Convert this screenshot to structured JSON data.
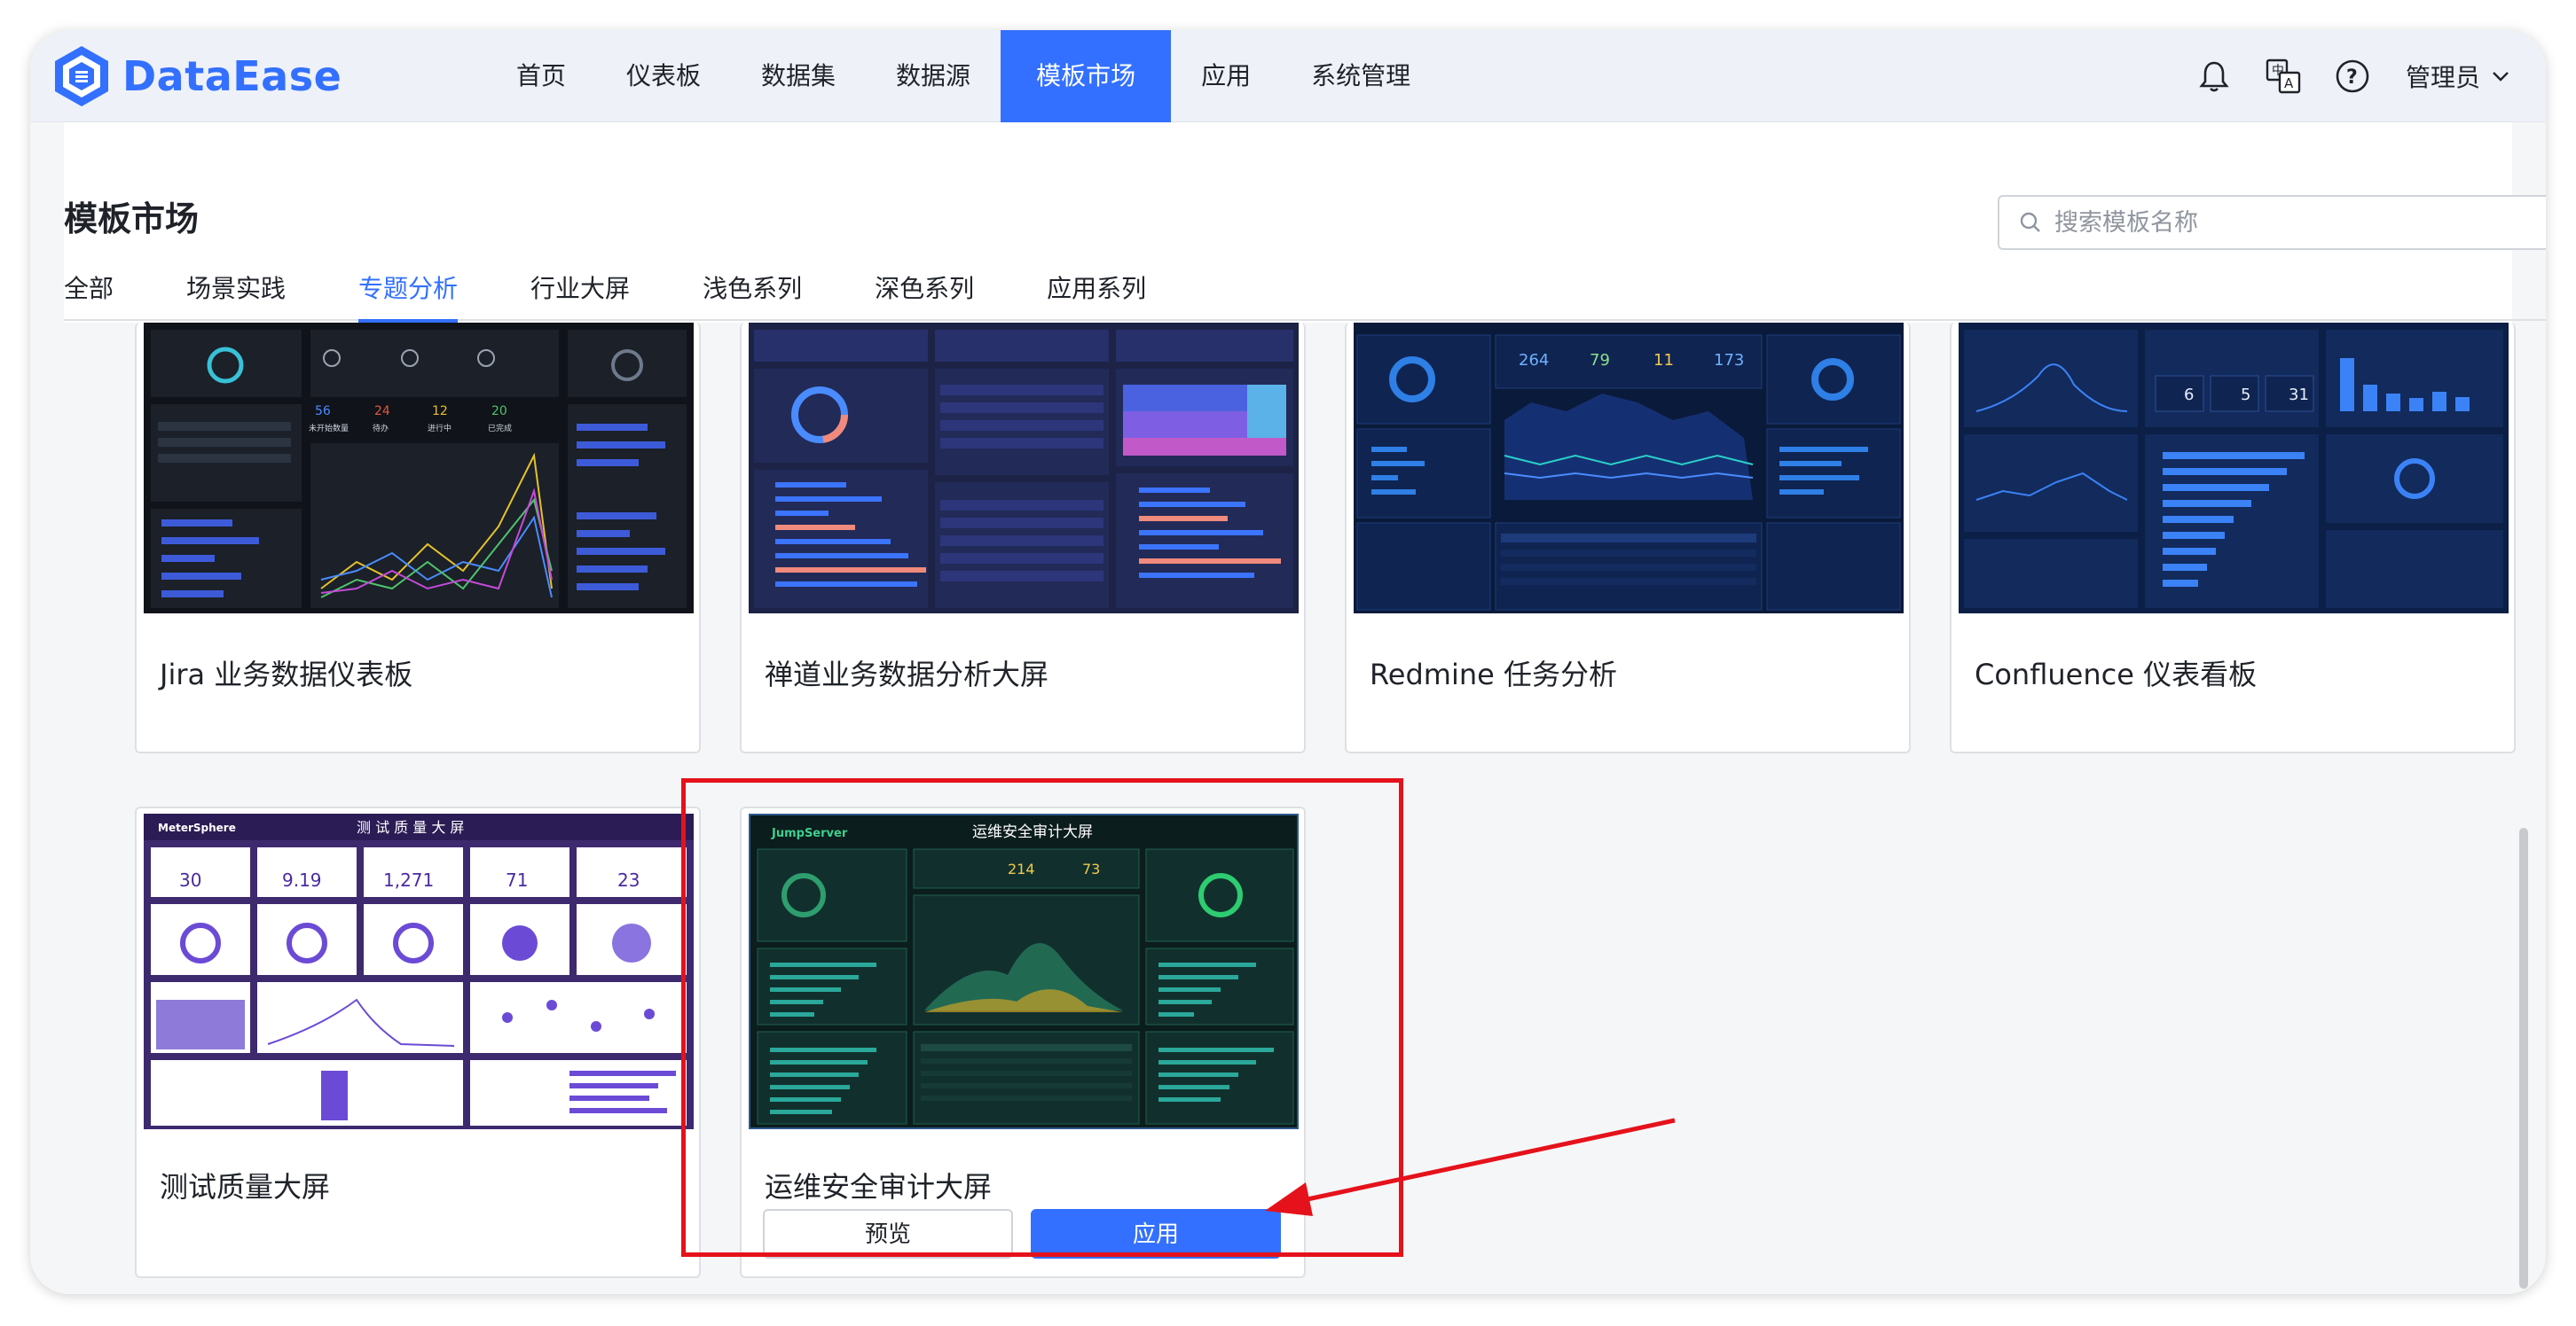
{
  "app": {
    "brand": "DataEase",
    "brand_color": "#3370ff"
  },
  "nav": {
    "items": [
      {
        "label": "首页"
      },
      {
        "label": "仪表板"
      },
      {
        "label": "数据集"
      },
      {
        "label": "数据源"
      },
      {
        "label": "模板市场",
        "active": true
      },
      {
        "label": "应用"
      },
      {
        "label": "系统管理"
      }
    ]
  },
  "header_actions": {
    "icons": [
      "bell-icon",
      "translate-icon",
      "help-icon"
    ],
    "user_label": "管理员"
  },
  "page": {
    "title": "模板市场",
    "search_placeholder": "搜索模板名称"
  },
  "tabs": [
    {
      "label": "全部"
    },
    {
      "label": "场景实践"
    },
    {
      "label": "专题分析",
      "active": true
    },
    {
      "label": "行业大屏"
    },
    {
      "label": "浅色系列"
    },
    {
      "label": "深色系列"
    },
    {
      "label": "应用系列"
    }
  ],
  "cards": [
    {
      "title": "Jira 业务数据仪表板"
    },
    {
      "title": "禅道业务数据分析大屏"
    },
    {
      "title": "Redmine 任务分析"
    },
    {
      "title": "Confluence 仪表看板"
    },
    {
      "title": "测试质量大屏"
    },
    {
      "title": "运维安全审计大屏",
      "preview_label": "预览",
      "apply_label": "应用",
      "highlighted": true
    }
  ],
  "thumbnails": {
    "jira": {
      "n1": "56",
      "n2": "24",
      "n3": "12",
      "n4": "20",
      "l1": "未开始数量",
      "l2": "待办",
      "l3": "进行中",
      "l4": "已完成"
    },
    "redmine": {
      "n1": "264",
      "n2": "79",
      "n3": "11",
      "n4": "173"
    },
    "confluence": {
      "n1": "6",
      "n2": "5",
      "n3": "31"
    },
    "metersphere": {
      "brand": "MeterSphere",
      "title": "测 试 质 量 大 屏",
      "n1": "30",
      "n2": "9.19",
      "n3": "1,271",
      "n4": "71",
      "n5": "23"
    },
    "jumpserver": {
      "brand": "JumpServer",
      "title": "运维安全审计大屏",
      "n1": "214",
      "n2": "73"
    }
  },
  "colors": {
    "highlight": "#e5121b",
    "primary": "#3370ff"
  }
}
